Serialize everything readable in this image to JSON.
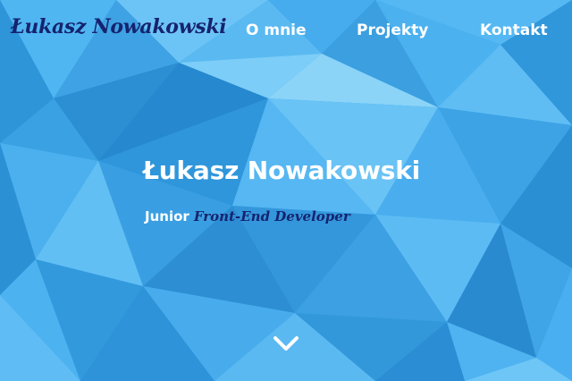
{
  "nav": {
    "logo_text": "Łukasz Nowakowski",
    "links": [
      {
        "label": "O mnie"
      },
      {
        "label": "Projekty"
      },
      {
        "label": "Kontakt"
      }
    ]
  },
  "hero": {
    "title": "Łukasz Nowakowski",
    "subtitle_plain": "Junior",
    "subtitle_script": "Front-End Developer"
  },
  "scroll_down": {
    "icon": "chevron-down-icon"
  },
  "colors": {
    "background_blue": "#3aa4e6",
    "navy_accent": "#16236e",
    "text_white": "#ffffff"
  }
}
